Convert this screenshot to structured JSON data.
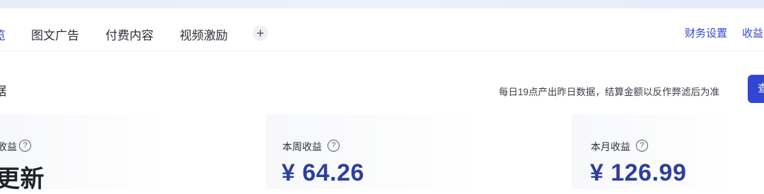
{
  "tabs": {
    "items": [
      {
        "label": "览",
        "active": true
      },
      {
        "label": "图文广告",
        "active": false
      },
      {
        "label": "付费内容",
        "active": false
      },
      {
        "label": "视频激励",
        "active": false
      }
    ],
    "add_icon": "plus-icon",
    "right_links": [
      "财务设置",
      "收益"
    ]
  },
  "section": {
    "title": "据",
    "notice": "每日19点产出昨日数据，结算金额以反作弊滤后为准",
    "button_label": "查"
  },
  "cards": [
    {
      "label": "收益",
      "value": "更新"
    },
    {
      "label": "本周收益",
      "value": "¥ 64.26"
    },
    {
      "label": "本月收益",
      "value": "¥ 126.99"
    }
  ],
  "icons": {
    "help": "question-mark"
  },
  "colors": {
    "accent": "#3346d3",
    "value_blue": "#2e3f9d"
  }
}
